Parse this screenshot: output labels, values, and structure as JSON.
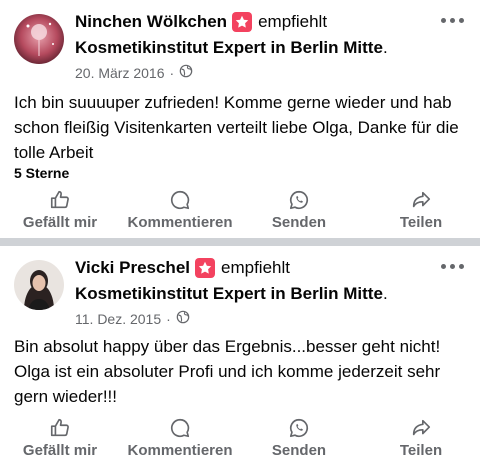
{
  "posts": [
    {
      "author": "Ninchen Wölkchen",
      "verb": "empfiehlt",
      "page": "Kosmetikinstitut Expert in Berlin Mitte",
      "page_suffix": ".",
      "date": "20. März 2016",
      "separator": "·",
      "text": "Ich bin suuuuper zufrieden!  Komme gerne wieder und hab schon fleißig Visitenkarten verteilt  liebe Olga, Danke für die tolle Arbeit",
      "rating": "5 Sterne"
    },
    {
      "author": "Vicki Preschel",
      "verb": "empfiehlt",
      "page": "Kosmetikinstitut Expert in Berlin Mitte",
      "page_suffix": ".",
      "date": "11. Dez. 2015",
      "separator": "·",
      "text": "Bin absolut happy über das Ergebnis...besser geht nicht! Olga ist ein absoluter Profi und ich komme jederzeit sehr gern wieder!!!"
    }
  ],
  "actions": {
    "like": "Gefällt mir",
    "comment": "Kommentieren",
    "send": "Senden",
    "share": "Teilen"
  },
  "icons": {
    "recommend": "star-badge-icon",
    "audience": "globe-icon",
    "more": "more-options-icon",
    "like": "thumbs-up-icon",
    "comment": "comment-bubble-icon",
    "send": "whatsapp-icon",
    "share": "share-arrow-icon"
  },
  "colors": {
    "badge": "#f3425f",
    "secondary_text": "#65676b",
    "divider": "#cfd2d6"
  }
}
